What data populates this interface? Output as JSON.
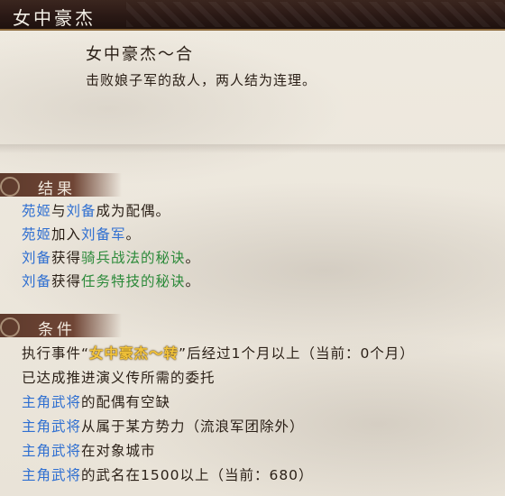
{
  "header": {
    "title": "女中豪杰"
  },
  "summary": {
    "title": "女中豪杰～合",
    "description": "击败娘子军的敌人，两人结为连理。"
  },
  "results": {
    "header": "结果",
    "lines": [
      {
        "a": "苑姬",
        "b": "与",
        "c": "刘备",
        "d": "成为配偶。"
      },
      {
        "a": "苑姬",
        "b": "加入",
        "c": "刘备军",
        "d": "。"
      },
      {
        "a": "刘备",
        "b": "获得",
        "c": "骑兵战法的秘诀",
        "d": "。"
      },
      {
        "a": "刘备",
        "b": "获得",
        "c": "任务特技的秘诀",
        "d": "。"
      }
    ]
  },
  "conditions": {
    "header": "条件",
    "line1": {
      "pre": "执行事件“",
      "event": "女中豪杰～转",
      "post": "”后经过1个月以上（当前：0个月）"
    },
    "line2": "已达成推进演义传所需的委托",
    "lines": [
      {
        "name": "主角武将",
        "text": "的配偶有空缺"
      },
      {
        "name": "主角武将",
        "text": "从属于某方势力（流浪军团除外）"
      },
      {
        "name": "主角武将",
        "text": "在对象城市"
      },
      {
        "name": "主角武将",
        "text": "的武名在1500以上（当前：680）"
      }
    ]
  },
  "colors": {
    "header_bg": "#2a1915",
    "section_band": "#6f4535",
    "name_blue": "#2f6fd1",
    "name_green": "#2c8a3a",
    "event_gold": "#f3c43a"
  }
}
